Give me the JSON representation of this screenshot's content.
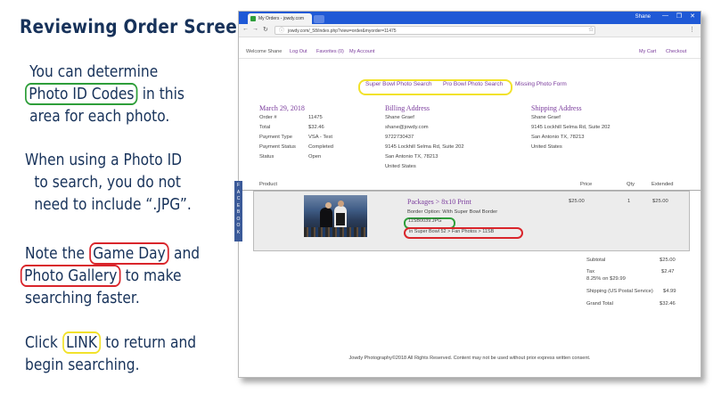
{
  "left_panel": {
    "heading": "Reviewing Order Screen:",
    "p1_pre": "You can determine",
    "p1_hl": "Photo ID Codes",
    "p1_post": " in this",
    "p1_line3": "area for each photo.",
    "p2_line1": "When using a Photo ID",
    "p2_line2": "to search, you do not",
    "p2_line3": "need to include “.JPG”.",
    "p3_pre": "Note the ",
    "p3_hl1": "Game Day",
    "p3_post1": " and",
    "p3_hl2": "Photo Gallery",
    "p3_post2": " to make",
    "p3_line3": "searching faster.",
    "p4_pre": "Click ",
    "p4_hl": "LINK",
    "p4_post": " to return and",
    "p4_line2": "begin searching."
  },
  "browser": {
    "tab_title": "My Orders - jowdy.com",
    "user": "Shane",
    "url": "jowdy.com/_58/index.php?view=order&myorder=11475"
  },
  "site_nav": {
    "welcome": "Welcome Shane",
    "logout": "Log Out",
    "favorites": "Favorites (0)",
    "my_account": "My Account",
    "my_cart": "My Cart",
    "checkout": "Checkout"
  },
  "search_links": {
    "super_bowl": "Super Bowl Photo Search",
    "pro_bowl": "Pro Bowl Photo Search",
    "missing": "Missing Photo Form"
  },
  "order": {
    "date": "March 29, 2018",
    "rows": [
      {
        "label": "Order #",
        "value": "11475"
      },
      {
        "label": "Total",
        "value": "$32.46"
      },
      {
        "label": "Payment Type",
        "value": "VSA - Test"
      },
      {
        "label": "Payment Status",
        "value": "Completed"
      },
      {
        "label": "Status",
        "value": "Open"
      }
    ]
  },
  "billing": {
    "title": "Billing Address",
    "lines": [
      "Shane Graef",
      "shane@jowdy.com",
      "9722730437",
      "9145 Lockhill Selma Rd, Suite 202",
      "San Antonio TX, 78213",
      "United States"
    ]
  },
  "shipping": {
    "title": "Shipping Address",
    "lines": [
      "Shane Graef",
      "9145 Lockhill Selma Rd, Suite 202",
      "San Antonio TX, 78213",
      "United States"
    ]
  },
  "table": {
    "product": "Product",
    "price": "Price",
    "qty": "Qty",
    "extended": "Extended"
  },
  "item": {
    "name": "Packages > 8x10 Print",
    "border": "Border Option: With Super Bowl Border",
    "code": "11SB0039.JPG",
    "gallery": "in Super Bowl 52 > Fan Photos > 11SB",
    "price": "$25.00",
    "qty": "1",
    "extended": "$25.00"
  },
  "facebook_letters": [
    "F",
    "A",
    "C",
    "E",
    "B",
    "O",
    "O",
    "K"
  ],
  "totals": {
    "subtotal_label": "Subtotal",
    "subtotal": "$25.00",
    "tax_label": "Tax",
    "tax_detail": "8.25% on $29.99",
    "tax": "$2.47",
    "shipping_label": "Shipping (US Postal Service)",
    "shipping": "$4.99",
    "grand_label": "Grand Total",
    "grand": "$32.46"
  },
  "footer": "Jowdy Photography©2018 All Rights Reserved. Content may not be used without prior express written consent.",
  "colors": {
    "highlight_green": "#2e9e3a",
    "highlight_red": "#d9252b",
    "highlight_yellow": "#f2e22b",
    "link_purple": "#7a3b9c",
    "text_navy": "#17325a"
  }
}
